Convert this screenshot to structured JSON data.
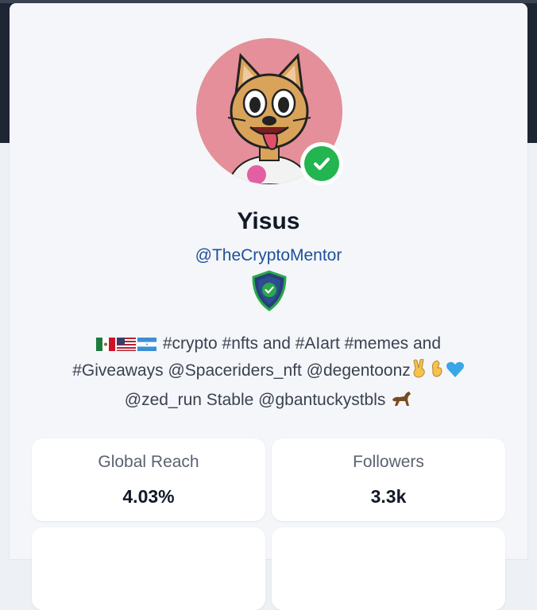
{
  "profile": {
    "name": "Yisus",
    "handle": "@TheCryptoMentor",
    "bio_line1": "#crypto #nfts and #AIart #memes and",
    "bio_line2": "#Giveaways @Spaceriders_nft @degentoonz",
    "bio_line3a": "@zed_run Stable @gbantuckystbls",
    "flags": [
      "mexico-flag-icon",
      "usa-flag-icon",
      "honduras-flag-icon"
    ],
    "verified": true
  },
  "stats": [
    {
      "label": "Global Reach",
      "value": "4.03%"
    },
    {
      "label": "Followers",
      "value": "3.3k"
    }
  ],
  "colors": {
    "topbar": "#1e2533",
    "verified_green": "#22b550",
    "handle_blue": "#1f4f9a",
    "shield_blue": "#24407a",
    "shield_green": "#2aa84a"
  }
}
